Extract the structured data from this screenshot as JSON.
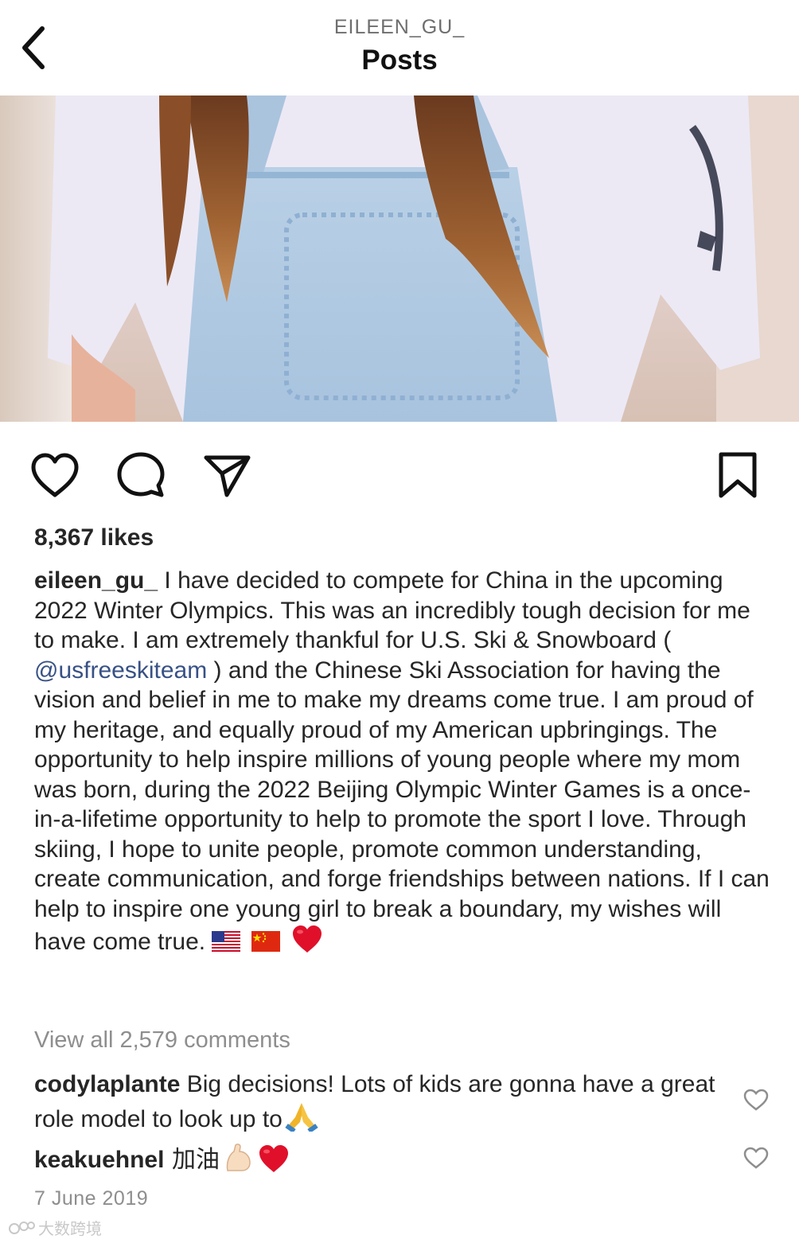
{
  "header": {
    "username": "EILEEN_GU_",
    "title": "Posts"
  },
  "post": {
    "likes": "8,367 likes",
    "caption": {
      "username": "eileen_gu_",
      "text_part1": " I have decided to compete for China in the upcoming 2022 Winter Olympics. This was an incredibly tough decision for me to make. I am extremely thankful for U.S. Ski & Snowboard ( ",
      "mention": "@usfreeskiteam",
      "text_part2": " ) and the Chinese Ski Association for having the vision and belief in me to make my dreams come true. I am proud of my heritage, and equally proud of my American upbringings. The opportunity to help inspire millions of young people where my mom was born, during the 2022 Beijing Olympic Winter Games is a once-in-a-lifetime opportunity to help to promote the sport I love. Through skiing, I hope to unite people, promote common understanding, create communication, and forge friendships between nations. If I can help to inspire one young girl to break a boundary, my wishes will have come true. "
    },
    "view_all_comments": "View all 2,579 comments",
    "comments": [
      {
        "username": "codylaplante",
        "text": " Big decisions! Lots of kids are gonna have a great role model to look up to"
      },
      {
        "username": "keakuehnel",
        "text": " 加油"
      }
    ],
    "date": "7 June 2019"
  },
  "icons": {
    "back": "chevron-left-icon",
    "like": "heart-icon",
    "comment": "speech-bubble-icon",
    "share": "paper-plane-icon",
    "save": "bookmark-icon"
  },
  "colors": {
    "text": "#262626",
    "muted": "#8e8e8e",
    "mention": "#385185",
    "heart_red": "#e0102a"
  },
  "watermark": "大数跨境"
}
